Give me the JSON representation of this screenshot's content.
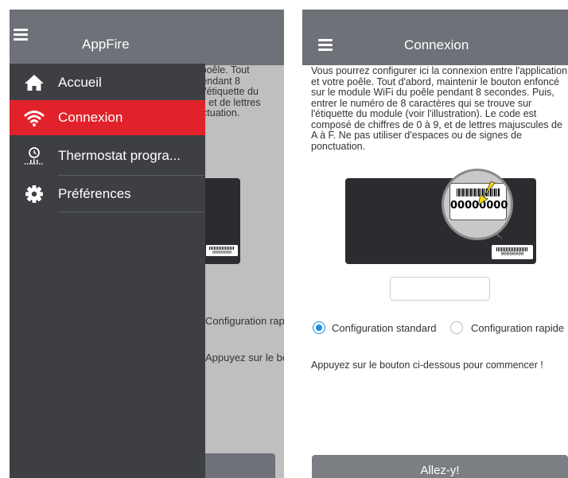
{
  "drawer": {
    "title": "AppFire",
    "items": [
      {
        "label": "Accueil",
        "icon": "home-icon"
      },
      {
        "label": "Connexion",
        "icon": "wifi-icon"
      },
      {
        "label": "Thermostat progra...",
        "icon": "thermostat-clock-icon"
      },
      {
        "label": "Préférences",
        "icon": "gear-icon"
      }
    ]
  },
  "connexion": {
    "title": "Connexion",
    "intro": "Vous pourrez configurer ici la connexion entre l'application et votre poêle. Tout d'abord, maintenir le bouton enfoncé sur le module WiFi du poêle pendant 8 secondes. Puis, entrer le numéro de 8 caractères qui se trouve sur l'étiquette du module (voir l'illustration). Le code est composé de chiffres de 0 à 9, et de lettres majuscules de A à F. Ne pas utiliser d'espaces ou de signes de ponctuation.",
    "illustration_code": "00000000",
    "code_input_value": "",
    "options": [
      {
        "label": "Configuration standard",
        "selected": true
      },
      {
        "label": "Configuration rapide",
        "selected": false
      }
    ],
    "hint": "Appuyez sur le bouton ci-dessous pour commencer !",
    "button_label": "Allez-y!"
  },
  "colors": {
    "topbar": "#6e7177",
    "drawer_bg": "#3d3f43",
    "active_item": "#e2222a",
    "radio_accent": "#1f8fe6"
  }
}
